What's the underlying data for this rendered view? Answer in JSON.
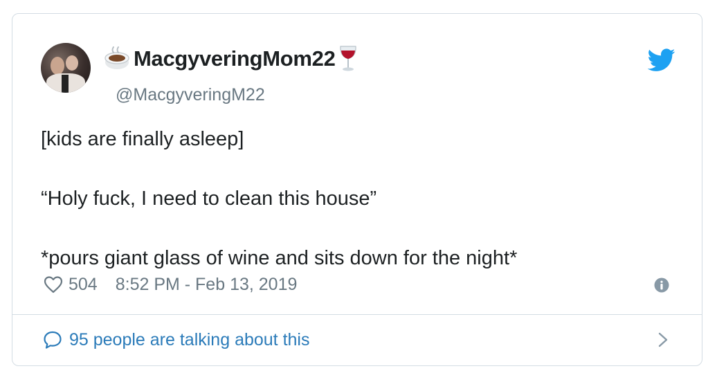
{
  "tweet": {
    "display_name": "MacgyveringMom22",
    "name_prefix_emoji": "hot-beverage-emoji",
    "name_suffix_emoji": "wine-glass-emoji",
    "handle": "@MacgyveringM22",
    "text_lines": [
      "[kids are finally asleep]",
      "“Holy fuck, I need to clean this house”",
      "*pours giant glass of wine and sits down for the night*"
    ],
    "like_count": "504",
    "timestamp": "8:52 PM - Feb 13, 2019",
    "conversation_link": "95 people are talking about this"
  },
  "icons": {
    "brand": "twitter-bird-icon",
    "like": "heart-icon",
    "info": "info-icon",
    "reply": "speech-bubble-icon",
    "more": "chevron-right-icon"
  },
  "colors": {
    "brand_blue": "#1da1f2",
    "link_blue": "#2b7bb9",
    "text": "#1c2022",
    "secondary_text": "#697882",
    "border": "#d3dce3"
  }
}
